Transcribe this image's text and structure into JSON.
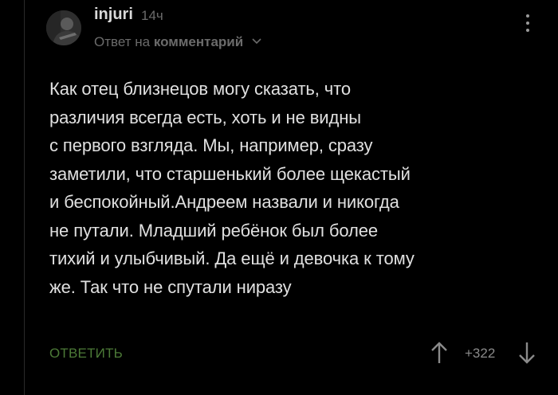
{
  "comment": {
    "author": "injuri",
    "time": "14ч",
    "reply_prefix": "Ответ на",
    "reply_link": "комментарий",
    "text_lines": [
      "Как отец близнецов могу сказать, что",
      "различия всегда есть, хоть и не видны",
      "с первого взгляда. Мы, например, сразу",
      "заметили, что старшенький более щекастый",
      "и беспокойный.Андреем назвали и никогда",
      "не путали. Младший ребёнок был более",
      "тихий и улыбчивый. Да ещё и девочка к тому",
      "же. Так что не спутали ниразу"
    ],
    "reply_button_label": "ОТВЕТИТЬ",
    "rating": "+322"
  },
  "icons": {
    "more_menu": "vertical-dots-icon",
    "reply_chevron": "chevron-down-icon",
    "vote_up": "arrow-up-icon",
    "vote_down": "arrow-down-icon"
  },
  "colors": {
    "background": "#000000",
    "text": "#e0e0e0",
    "muted": "#6b6b6b",
    "reply_button": "#4c7a37"
  }
}
